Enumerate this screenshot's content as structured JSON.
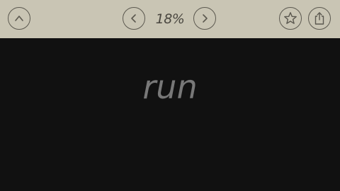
{
  "toolbar": {
    "up_icon": "chevron-up-icon",
    "prev_icon": "chevron-left-icon",
    "next_icon": "chevron-right-icon",
    "favorite_icon": "star-icon",
    "share_icon": "share-icon",
    "progress_text": "18%"
  },
  "reader": {
    "current_word": "run"
  },
  "colors": {
    "toolbar_bg": "#c9c5b4",
    "content_bg": "#111111",
    "word_color": "#787878",
    "icon_color": "#5b584f"
  }
}
